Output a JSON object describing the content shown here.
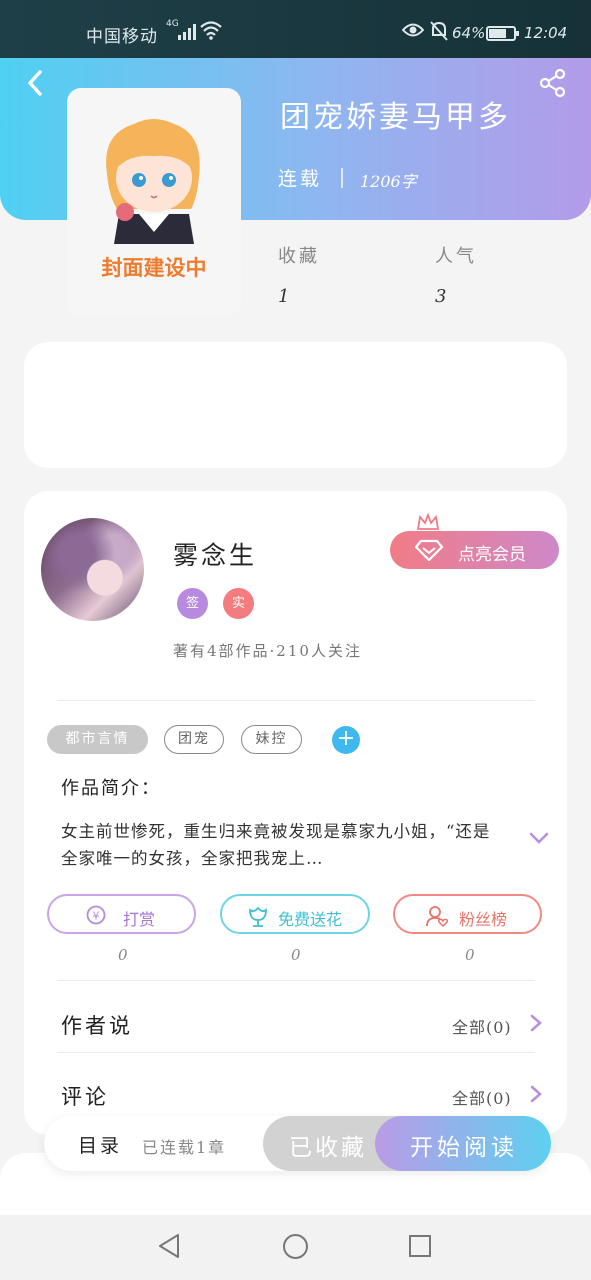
{
  "status_bar": {
    "carrier": "中国移动",
    "network": "4G",
    "battery": "64%",
    "time": "12:04"
  },
  "book": {
    "title": "团宠娇妻马甲多",
    "status": "连载",
    "word_count": "1206字",
    "cover_label": "封面建设中",
    "stats": {
      "favorites_label": "收藏",
      "favorites_value": "1",
      "popularity_label": "人气",
      "popularity_value": "3"
    }
  },
  "author": {
    "name": "雾念生",
    "badge_sign": "签",
    "badge_real": "实",
    "meta": "著有4部作品·210人关注",
    "vip_button": "点亮会员"
  },
  "tags": {
    "genre": "都市言情",
    "items": [
      "团宠",
      "妹控"
    ],
    "add_icon": "plus-icon"
  },
  "intro": {
    "title": "作品简介：",
    "text": "女主前世惨死，重生归来竟被发现是慕家九小姐，“还是全家唯一的女孩，全家把我宠上…"
  },
  "actions": {
    "tip": {
      "label": "打赏",
      "count": "0"
    },
    "flower": {
      "label": "免费送花",
      "count": "0"
    },
    "fans": {
      "label": "粉丝榜",
      "count": "0"
    }
  },
  "sections": {
    "author_says": {
      "title": "作者说",
      "link": "全部(0)"
    },
    "comments": {
      "title": "评论",
      "link": "全部(0)"
    }
  },
  "bottom_bar": {
    "toc_label": "目录",
    "toc_count": "已连载1章",
    "collected_label": "已收藏",
    "read_label": "开始阅读"
  },
  "colors": {
    "hero_gradient_start": "#4fd0f2",
    "hero_gradient_end": "#b39be9",
    "vip_gradient_start": "#f17c85",
    "vip_gradient_end": "#ce88c9",
    "accent_blue": "#3fb8ef",
    "cover_label": "#ee7c2e"
  }
}
